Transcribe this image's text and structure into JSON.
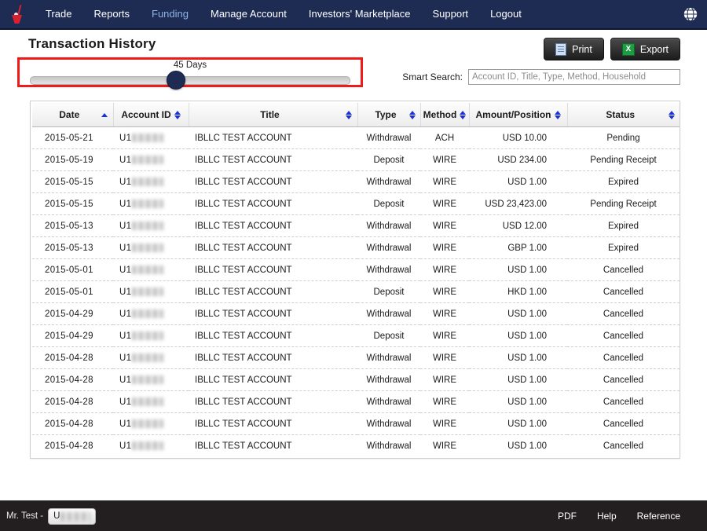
{
  "nav": {
    "logo_name": "broker-logo",
    "items": [
      {
        "label": "Trade",
        "active": false
      },
      {
        "label": "Reports",
        "active": false
      },
      {
        "label": "Funding",
        "active": true
      },
      {
        "label": "Manage Account",
        "active": false
      },
      {
        "label": "Investors' Marketplace",
        "active": false
      },
      {
        "label": "Support",
        "active": false
      },
      {
        "label": "Logout",
        "active": false
      }
    ],
    "globe_icon": "globe-icon"
  },
  "page": {
    "title": "Transaction History"
  },
  "toolbar": {
    "print_label": "Print",
    "print_icon": "document-icon",
    "export_label": "Export",
    "export_icon": "excel-icon",
    "export_icon_glyph": "X"
  },
  "slider": {
    "value_label": "45 Days",
    "days": 45,
    "handle_percent": 45,
    "highlight_color": "#ef1a1a"
  },
  "search": {
    "label": "Smart Search:",
    "placeholder": "Account ID, Title, Type, Method, Household",
    "value": ""
  },
  "table": {
    "columns": [
      {
        "label": "Date",
        "sort": "asc",
        "align": "left"
      },
      {
        "label": "Account ID",
        "sort": "none",
        "align": "left"
      },
      {
        "label": "Title",
        "sort": "none",
        "align": "center"
      },
      {
        "label": "Type",
        "sort": "none",
        "align": "center"
      },
      {
        "label": "Method",
        "sort": "none",
        "align": "center"
      },
      {
        "label": "Amount/Position",
        "sort": "none",
        "align": "right"
      },
      {
        "label": "Status",
        "sort": "none",
        "align": "center"
      }
    ],
    "account_prefix": "U1",
    "account_masked": true,
    "rows": [
      {
        "date": "2015-05-21",
        "account": "U1",
        "title": "IBLLC  TEST ACCOUNT",
        "type": "Withdrawal",
        "method": "ACH",
        "amount": "USD 10.00",
        "status": "Pending"
      },
      {
        "date": "2015-05-19",
        "account": "U1",
        "title": "IBLLC  TEST ACCOUNT",
        "type": "Deposit",
        "method": "WIRE",
        "amount": "USD 234.00",
        "status": "Pending Receipt"
      },
      {
        "date": "2015-05-15",
        "account": "U1",
        "title": "IBLLC  TEST ACCOUNT",
        "type": "Withdrawal",
        "method": "WIRE",
        "amount": "USD 1.00",
        "status": "Expired"
      },
      {
        "date": "2015-05-15",
        "account": "U1",
        "title": "IBLLC  TEST ACCOUNT",
        "type": "Deposit",
        "method": "WIRE",
        "amount": "USD 23,423.00",
        "status": "Pending Receipt"
      },
      {
        "date": "2015-05-13",
        "account": "U1",
        "title": "IBLLC  TEST ACCOUNT",
        "type": "Withdrawal",
        "method": "WIRE",
        "amount": "USD 12.00",
        "status": "Expired"
      },
      {
        "date": "2015-05-13",
        "account": "U1",
        "title": "IBLLC  TEST ACCOUNT",
        "type": "Withdrawal",
        "method": "WIRE",
        "amount": "GBP 1.00",
        "status": "Expired"
      },
      {
        "date": "2015-05-01",
        "account": "U1",
        "title": "IBLLC  TEST ACCOUNT",
        "type": "Withdrawal",
        "method": "WIRE",
        "amount": "USD 1.00",
        "status": "Cancelled"
      },
      {
        "date": "2015-05-01",
        "account": "U1",
        "title": "IBLLC  TEST ACCOUNT",
        "type": "Deposit",
        "method": "WIRE",
        "amount": "HKD 1.00",
        "status": "Cancelled"
      },
      {
        "date": "2015-04-29",
        "account": "U1",
        "title": "IBLLC  TEST ACCOUNT",
        "type": "Withdrawal",
        "method": "WIRE",
        "amount": "USD 1.00",
        "status": "Cancelled"
      },
      {
        "date": "2015-04-29",
        "account": "U1",
        "title": "IBLLC  TEST ACCOUNT",
        "type": "Deposit",
        "method": "WIRE",
        "amount": "USD 1.00",
        "status": "Cancelled"
      },
      {
        "date": "2015-04-28",
        "account": "U1",
        "title": "IBLLC  TEST ACCOUNT",
        "type": "Withdrawal",
        "method": "WIRE",
        "amount": "USD 1.00",
        "status": "Cancelled"
      },
      {
        "date": "2015-04-28",
        "account": "U1",
        "title": "IBLLC  TEST ACCOUNT",
        "type": "Withdrawal",
        "method": "WIRE",
        "amount": "USD 1.00",
        "status": "Cancelled"
      },
      {
        "date": "2015-04-28",
        "account": "U1",
        "title": "IBLLC  TEST ACCOUNT",
        "type": "Withdrawal",
        "method": "WIRE",
        "amount": "USD 1.00",
        "status": "Cancelled"
      },
      {
        "date": "2015-04-28",
        "account": "U1",
        "title": "IBLLC  TEST ACCOUNT",
        "type": "Withdrawal",
        "method": "WIRE",
        "amount": "USD 1.00",
        "status": "Cancelled"
      },
      {
        "date": "2015-04-28",
        "account": "U1",
        "title": "IBLLC  TEST ACCOUNT",
        "type": "Withdrawal",
        "method": "WIRE",
        "amount": "USD 1.00",
        "status": "Cancelled"
      }
    ]
  },
  "footer": {
    "user_label": "Mr. Test -",
    "account_prefix": "U",
    "links": [
      "PDF",
      "Help",
      "Reference"
    ]
  },
  "colors": {
    "nav_bg": "#1e2c54",
    "footer_bg": "#231f20",
    "accent_link": "#8fb4e8",
    "sort_arrow": "#1a31d8",
    "highlight": "#ef1a1a"
  }
}
